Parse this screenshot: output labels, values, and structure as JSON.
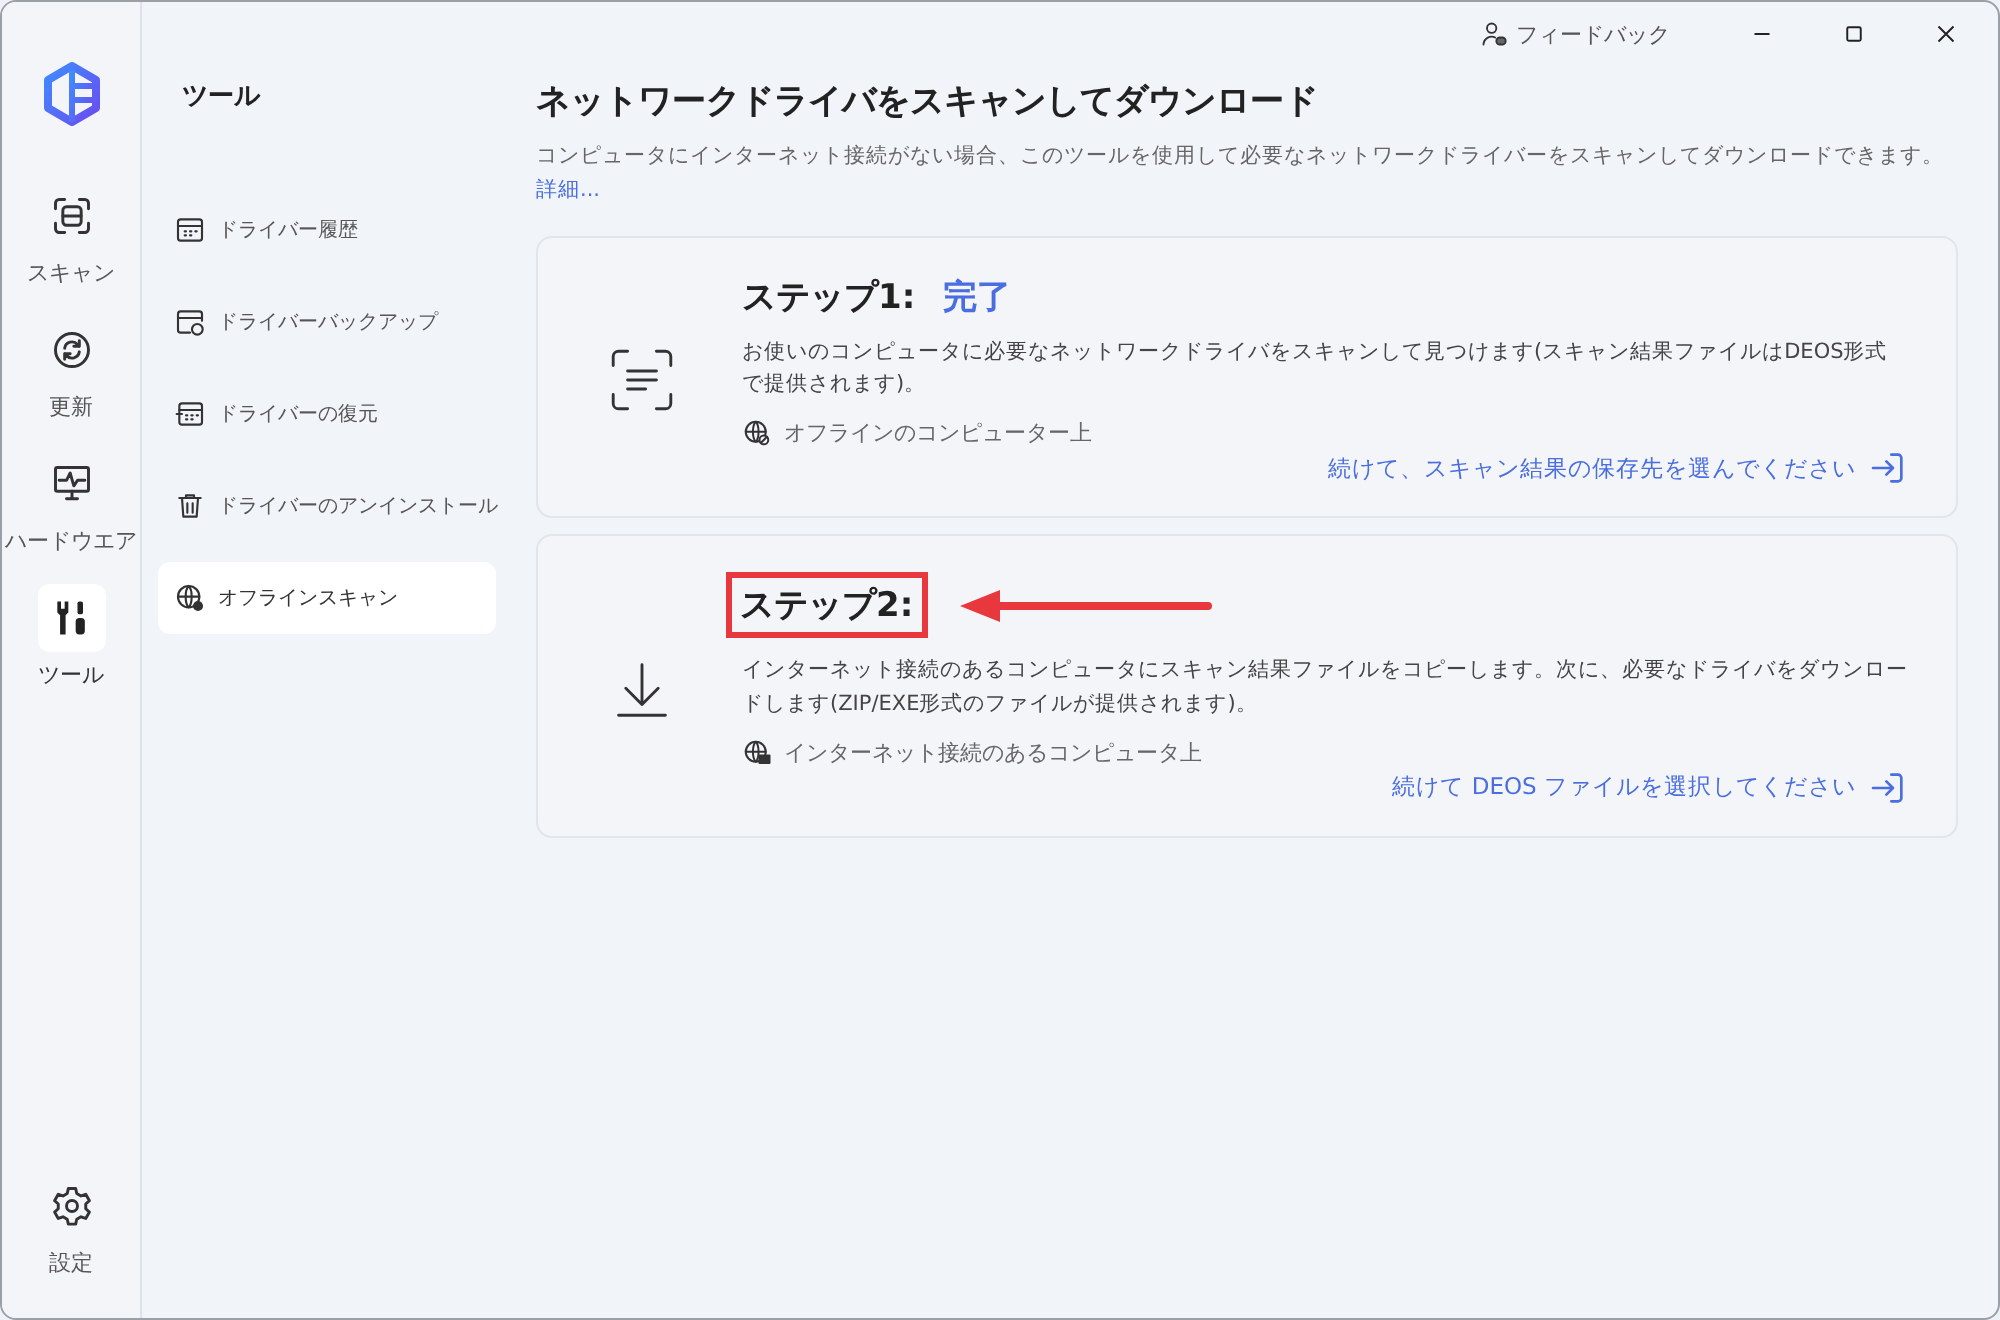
{
  "titlebar": {
    "feedback": "フィードバック"
  },
  "rail": {
    "items": [
      {
        "kind": "scan",
        "label": "スキャン",
        "selected": false
      },
      {
        "kind": "update",
        "label": "更新",
        "selected": false
      },
      {
        "kind": "hardware",
        "label": "ハードウエア",
        "selected": false
      },
      {
        "kind": "tools",
        "label": "ツール",
        "selected": true
      }
    ],
    "settings": {
      "label": "設定"
    }
  },
  "sidebar": {
    "title": "ツール",
    "items": [
      {
        "kind": "history",
        "label": "ドライバー履歴",
        "selected": false
      },
      {
        "kind": "backup",
        "label": "ドライバーバックアップ",
        "selected": false
      },
      {
        "kind": "restore",
        "label": "ドライバーの復元",
        "selected": false
      },
      {
        "kind": "uninstall",
        "label": "ドライバーのアンインストール",
        "selected": false
      },
      {
        "kind": "offline",
        "label": "オフラインスキャン",
        "selected": true
      }
    ]
  },
  "main": {
    "title": "ネットワークドライバをスキャンしてダウンロード",
    "description": "コンピュータにインターネット接続がない場合、このツールを使用して必要なネットワークドライバーをスキャンしてダウンロードできます。",
    "details_link": "詳細...",
    "steps": [
      {
        "kind": "scan",
        "title": "ステップ1:",
        "status": "完了",
        "highlighted": false,
        "description": "お使いのコンピュータに必要なネットワークドライバをスキャンして見つけます(スキャン結果ファイルはDEOS形式で提供されます)。",
        "location": "オフラインのコンピューター上",
        "action": "続けて、スキャン結果の保存先を選んでください"
      },
      {
        "kind": "download",
        "title": "ステップ2:",
        "highlighted": true,
        "description": "インターネット接続のあるコンピュータにスキャン結果ファイルをコピーします。次に、必要なドライバをダウンロードします(ZIP/EXE形式のファイルが提供されます)。",
        "location": "インターネット接続のあるコンピュータ上",
        "action": "続けて DEOS ファイルを選択してください"
      }
    ]
  }
}
